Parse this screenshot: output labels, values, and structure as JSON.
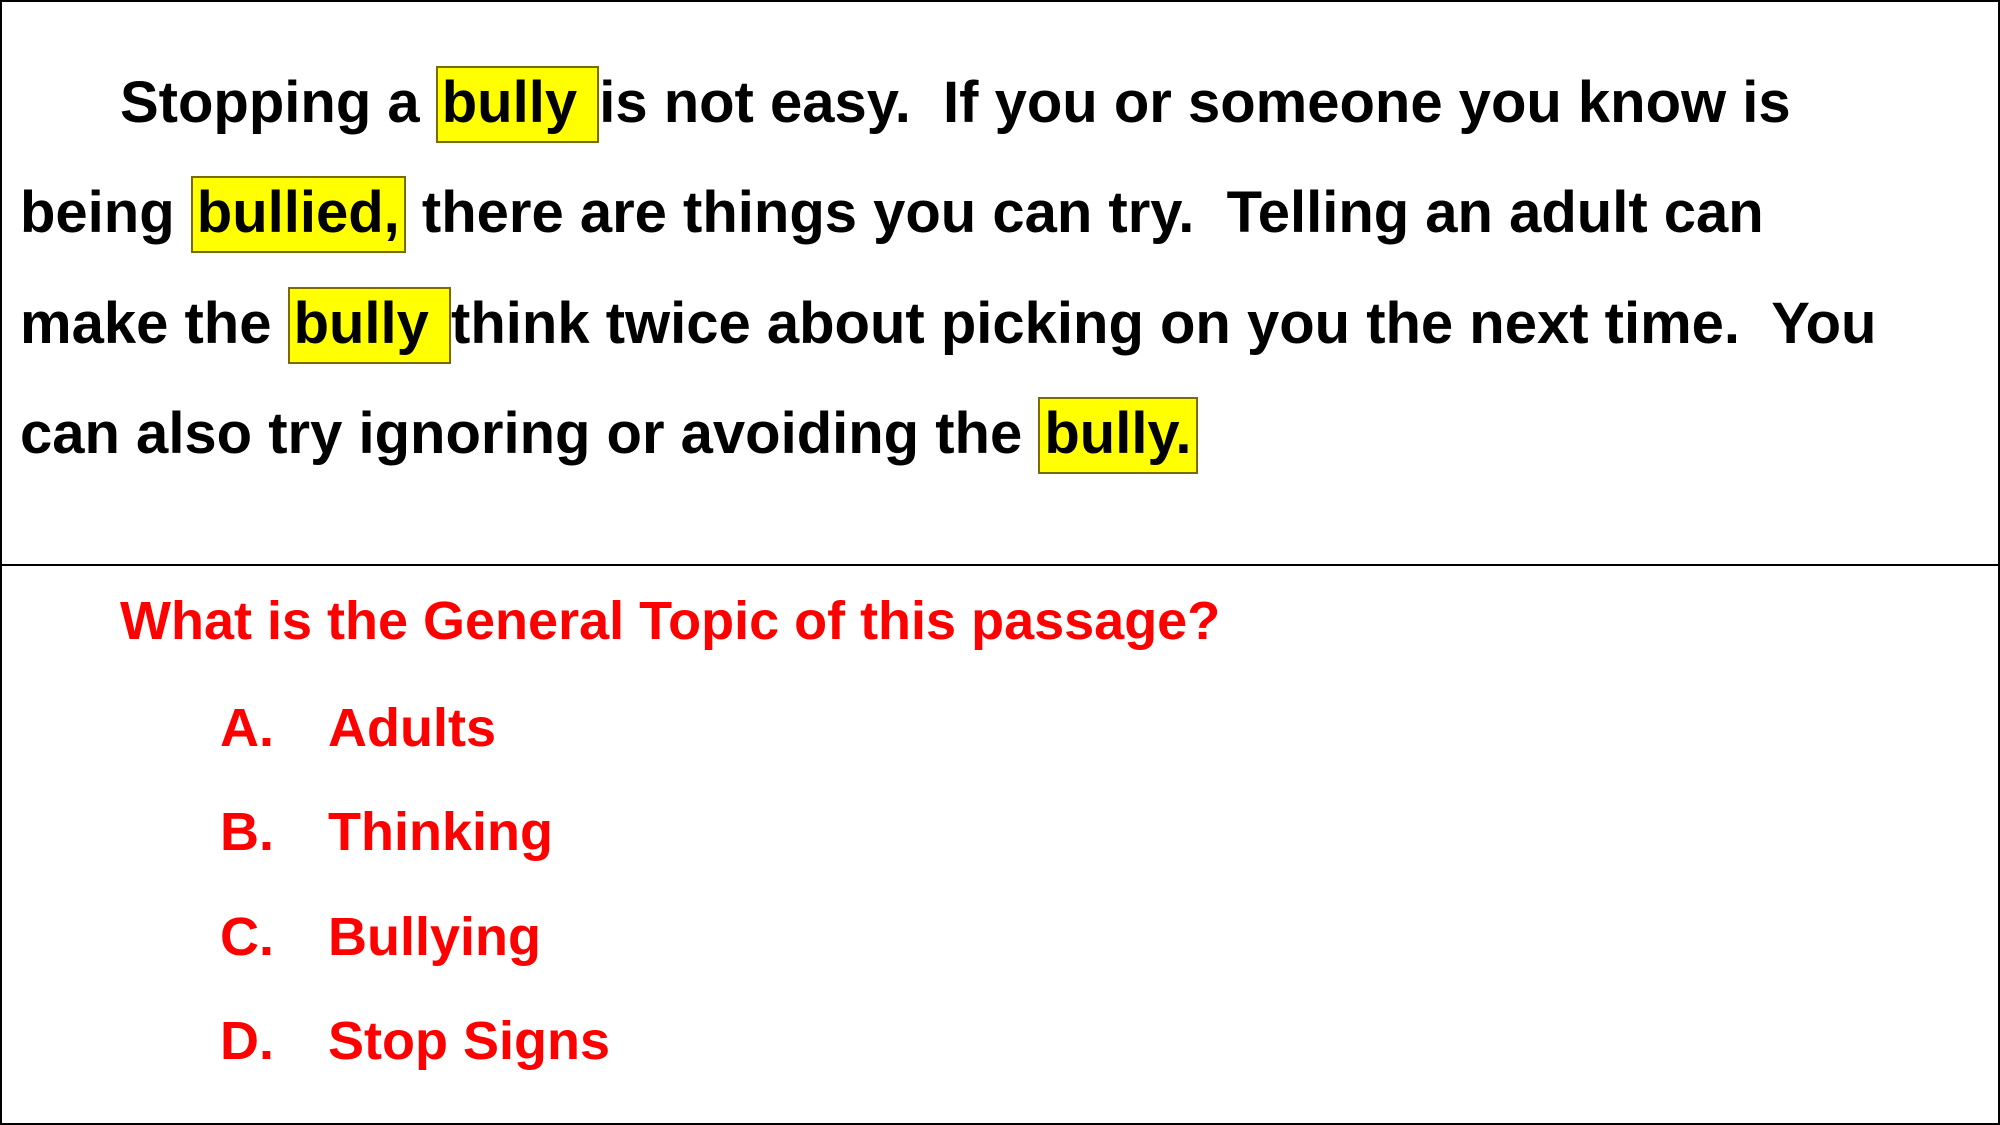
{
  "passage": {
    "line1": {
      "before": "Stopping a ",
      "highlight": "bully ",
      "after": "is not easy.  If you or someone you know is"
    },
    "line2": {
      "before": "being ",
      "highlight": "bullied,",
      "after": " there are things you can try.  Telling an adult can"
    },
    "line3": {
      "before": "make the ",
      "highlight": "bully ",
      "after": "think twice about picking on you the next time.  You"
    },
    "line4": {
      "before": "can also try ignoring or avoiding the ",
      "highlight": "bully.",
      "after": ""
    },
    "highlight_color": "#ffff00",
    "text_color": "#000000"
  },
  "quiz": {
    "question": "What is the General Topic of this passage?",
    "accent_color": "#ff0000",
    "options": [
      {
        "letter": "A.",
        "text": "Adults"
      },
      {
        "letter": "B.",
        "text": "Thinking"
      },
      {
        "letter": "C.",
        "text": "Bullying"
      },
      {
        "letter": "D.",
        "text": "Stop Signs"
      }
    ]
  }
}
